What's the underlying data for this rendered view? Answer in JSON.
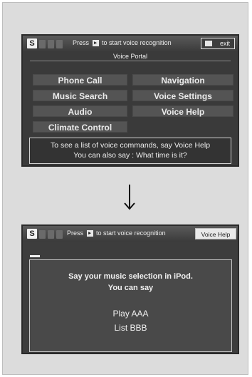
{
  "screen1": {
    "top_bar": {
      "voice_icon": "S",
      "prompt_before": "Press",
      "talk_icon": "talk-icon",
      "prompt_after": "to start voice recognition",
      "exit_label": "exit"
    },
    "title": "Voice Portal",
    "menu": {
      "phone_call": "Phone Call",
      "navigation": "Navigation",
      "music_search": "Music Search",
      "voice_settings": "Voice Settings",
      "audio": "Audio",
      "voice_help": "Voice Help",
      "climate_control": "Climate Control"
    },
    "hint_line1": "To see a list of voice commands, say Voice Help",
    "hint_line2": "You can also say : What time is it?"
  },
  "screen2": {
    "top_bar": {
      "voice_icon": "S",
      "prompt_before": "Press",
      "prompt_after": "to start voice recognition",
      "voice_help_button": "Voice Help"
    },
    "line1": "Say your music selection in iPod.",
    "line2": "You can say",
    "example1": "Play AAA",
    "example2": "List BBB"
  },
  "colors": {
    "page_background": "#dcdcdc",
    "screen_background": "#3a3a3a",
    "button_background": "#545454",
    "text_light": "#eaeaea"
  }
}
